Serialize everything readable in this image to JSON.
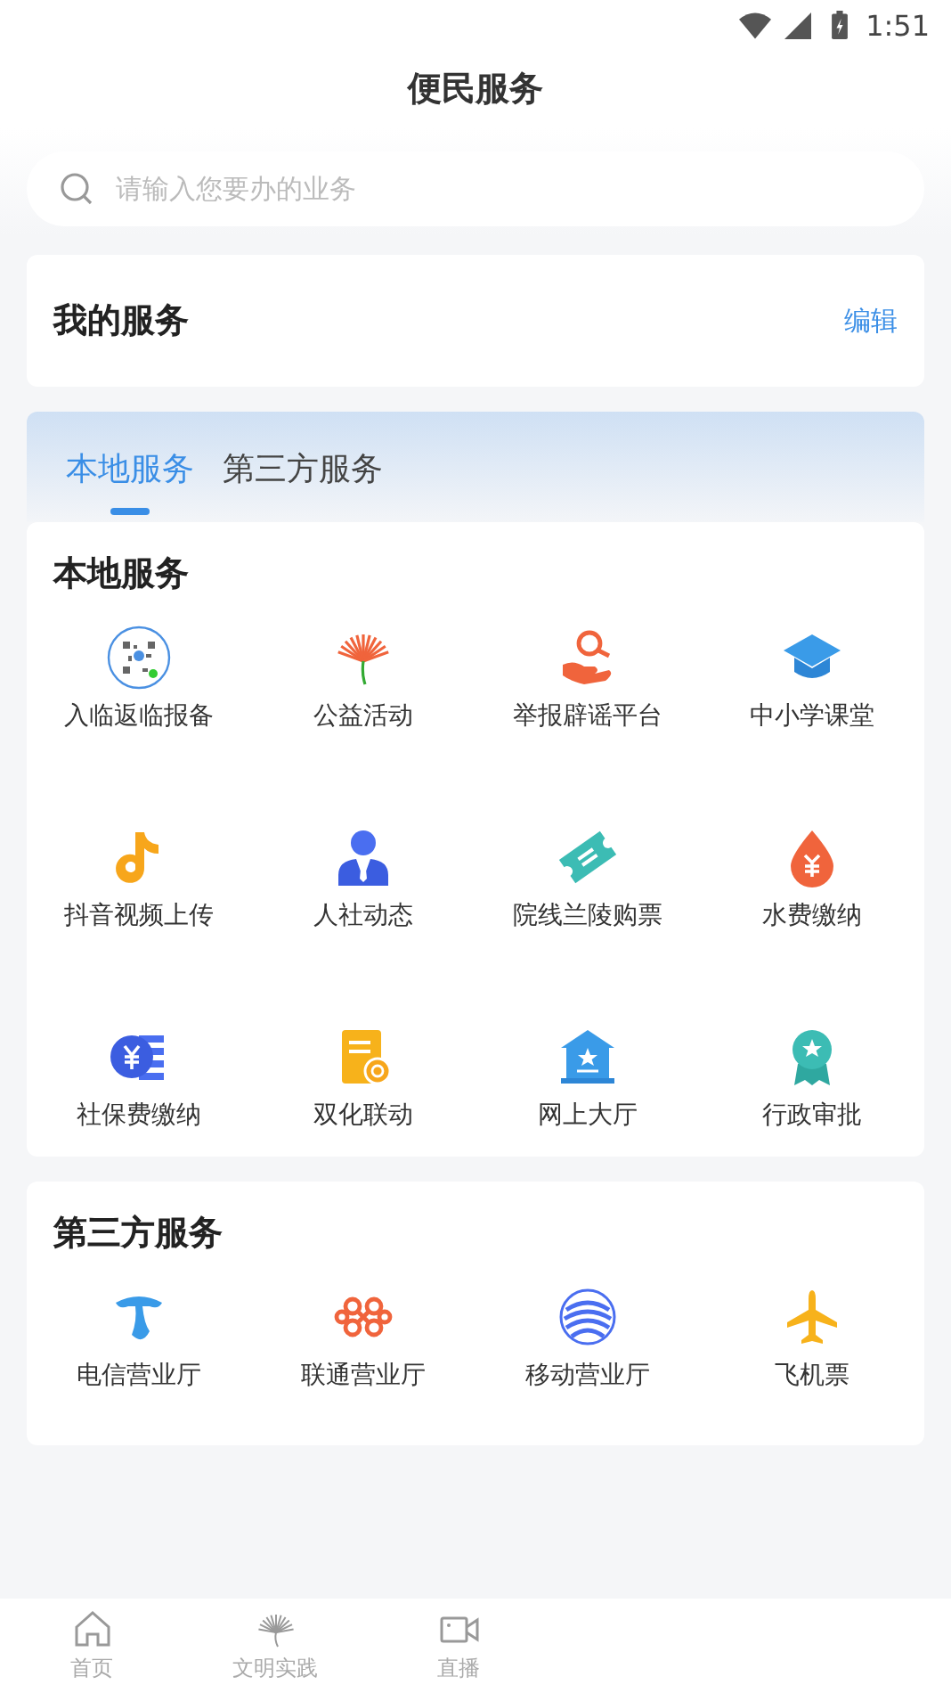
{
  "status_bar": {
    "time": "1:51"
  },
  "header": {
    "title": "便民服务"
  },
  "search": {
    "placeholder": "请输入您要办的业务"
  },
  "my_services": {
    "title": "我的服务",
    "action": "编辑"
  },
  "tabs": [
    {
      "label": "本地服务",
      "selected": true
    },
    {
      "label": "第三方服务",
      "selected": false
    }
  ],
  "sections": [
    {
      "title": "本地服务",
      "items": [
        {
          "label": "入临返临报备"
        },
        {
          "label": "公益活动"
        },
        {
          "label": "举报辟谣平台"
        },
        {
          "label": "中小学课堂"
        },
        {
          "label": "抖音视频上传"
        },
        {
          "label": "人社动态"
        },
        {
          "label": "院线兰陵购票"
        },
        {
          "label": "水费缴纳"
        },
        {
          "label": "社保费缴纳"
        },
        {
          "label": "双化联动"
        },
        {
          "label": "网上大厅"
        },
        {
          "label": "行政审批"
        }
      ]
    },
    {
      "title": "第三方服务",
      "items": [
        {
          "label": "电信营业厅"
        },
        {
          "label": "联通营业厅"
        },
        {
          "label": "移动营业厅"
        },
        {
          "label": "飞机票"
        }
      ]
    }
  ],
  "bottom_nav": [
    {
      "label": "首页"
    },
    {
      "label": "文明实践"
    },
    {
      "label": "直播"
    }
  ]
}
